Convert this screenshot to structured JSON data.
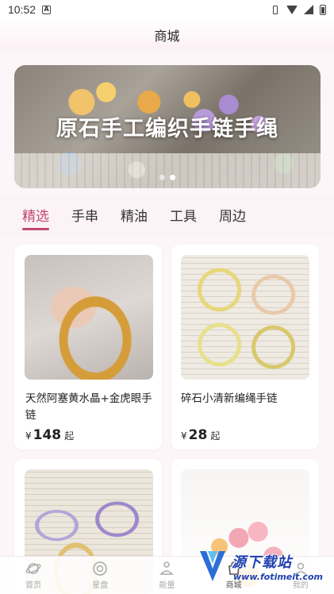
{
  "status_bar": {
    "time": "10:52",
    "icons": [
      "a-notification-icon",
      "vibrate-icon",
      "wifi-icon",
      "signal-icon",
      "battery-icon"
    ]
  },
  "header": {
    "title": "商城"
  },
  "banner": {
    "title": "原石手工编织手链手绳",
    "slide_count": 2,
    "active_slide": 2
  },
  "tabs": [
    {
      "label": "精选",
      "active": true
    },
    {
      "label": "手串",
      "active": false
    },
    {
      "label": "精油",
      "active": false
    },
    {
      "label": "工具",
      "active": false
    },
    {
      "label": "周边",
      "active": false
    }
  ],
  "products": [
    {
      "name": "天然阿塞黄水晶+金虎眼手链",
      "currency": "¥",
      "price": "148",
      "price_suffix": "起"
    },
    {
      "name": "碎石小清新编绳手链",
      "currency": "¥",
      "price": "28",
      "price_suffix": "起"
    },
    {
      "name": "",
      "currency": "",
      "price": "",
      "price_suffix": ""
    },
    {
      "name": "",
      "currency": "",
      "price": "",
      "price_suffix": ""
    }
  ],
  "bottom_nav": [
    {
      "label": "首页",
      "icon": "planet-icon",
      "active": false
    },
    {
      "label": "星盘",
      "icon": "astrolabe-icon",
      "active": false
    },
    {
      "label": "能量",
      "icon": "meditation-icon",
      "active": false
    },
    {
      "label": "商城",
      "icon": "shop-icon",
      "active": true
    },
    {
      "label": "我的",
      "icon": "profile-icon",
      "active": false
    }
  ],
  "watermark": {
    "text": "源下载站",
    "url": "www.fotimeit.com"
  },
  "colors": {
    "accent": "#c2466f",
    "page_bg": "#fdf6f8"
  }
}
